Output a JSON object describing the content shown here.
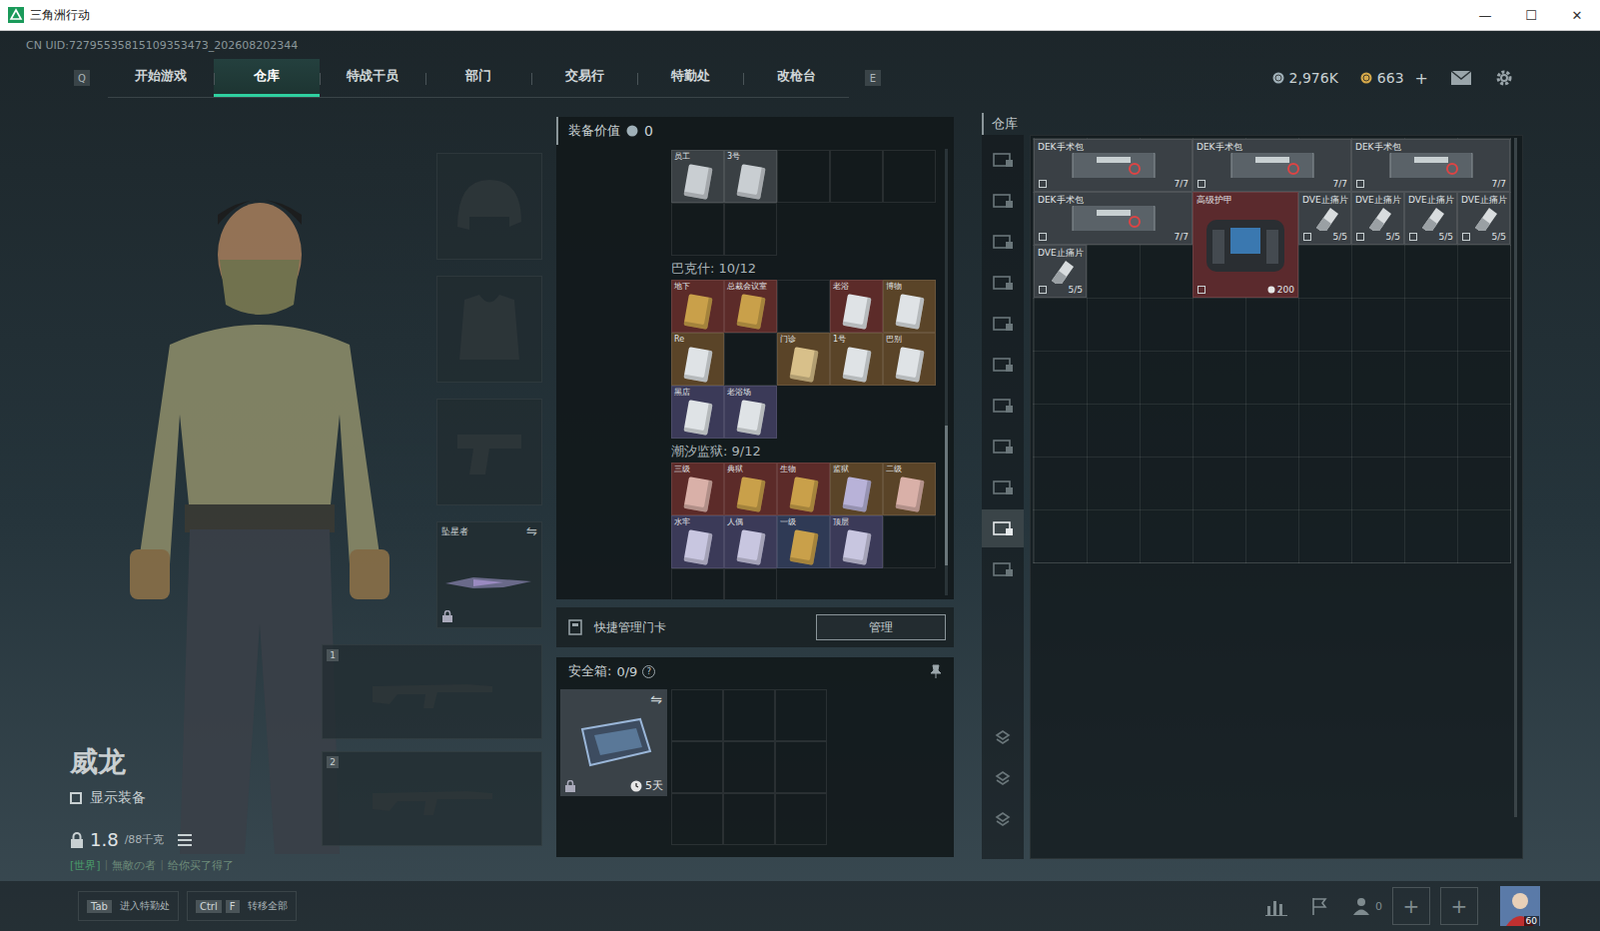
{
  "window": {
    "title": "三角洲行动",
    "controls": [
      "—",
      "☐",
      "✕"
    ]
  },
  "uid": "CN UID:72795535815109353473_202608202344",
  "nav": {
    "prev_key": "Q",
    "next_key": "E",
    "tabs": [
      {
        "label": "开始游戏",
        "selected": false
      },
      {
        "label": "仓库",
        "selected": true
      },
      {
        "label": "特战干员",
        "selected": false
      },
      {
        "label": "部门",
        "selected": false
      },
      {
        "label": "交易行",
        "selected": false
      },
      {
        "label": "特勤处",
        "selected": false
      },
      {
        "label": "改枪台",
        "selected": false
      }
    ]
  },
  "currency": [
    {
      "value": "2,976K",
      "color": "#9fb0b8",
      "add": ""
    },
    {
      "value": "663",
      "color": "#d4a84a",
      "add": "+"
    }
  ],
  "operator": {
    "name": "威龙",
    "show_gear": {
      "label": "显示装备",
      "checked": false
    },
    "weight": "1.8",
    "capacity": "/88千克"
  },
  "chat": {
    "channel": "[世界]",
    "sender": "無敵の者",
    "message": "给你买了得了"
  },
  "gear_slots": [
    {
      "kind": "helmet",
      "label": "",
      "swap": "",
      "locked": false
    },
    {
      "kind": "armor",
      "label": "",
      "swap": "",
      "locked": false
    },
    {
      "kind": "pistol",
      "label": "",
      "swap": "",
      "locked": false
    },
    {
      "kind": "melee",
      "label": "坠星者",
      "swap": "⇋",
      "locked": true
    }
  ],
  "weapon_slots": [
    "1",
    "2"
  ],
  "loadout": {
    "title": "装备价值",
    "value": "0"
  },
  "key_sections": [
    {
      "title": "",
      "slots": [
        {
          "label": "员工",
          "color": "#3a4044",
          "card": "#c9ced2",
          "empty": false
        },
        {
          "label": "3号",
          "color": "#3a4044",
          "card": "#c9ced2",
          "empty": false
        },
        {
          "empty": true
        },
        {
          "empty": true
        },
        {
          "empty": true
        },
        {
          "empty": true
        },
        {
          "empty": true
        }
      ]
    },
    {
      "title": "巴克什: 10/12",
      "slots": [
        {
          "label": "地下",
          "color": "#5c2b29",
          "card": "#c9a04a",
          "empty": false
        },
        {
          "label": "总裁会议室",
          "color": "#5c2b29",
          "card": "#c9a04a",
          "empty": false
        },
        {
          "empty": true
        },
        {
          "label": "老浴",
          "color": "#5c2b29",
          "card": "#dfe3e6",
          "empty": false
        },
        {
          "label": "博物",
          "color": "#5a4428",
          "card": "#dfe3e6",
          "empty": false
        },
        {
          "label": "Re",
          "color": "#5a4428",
          "card": "#dfe3e6",
          "empty": false
        },
        {
          "empty": true
        },
        {
          "label": "门诊",
          "color": "#5a4428",
          "card": "#d8c08a",
          "empty": false
        },
        {
          "label": "1号",
          "color": "#5a4428",
          "card": "#dfe3e6",
          "empty": false
        },
        {
          "label": "巴别",
          "color": "#5a4428",
          "card": "#dfe3e6",
          "empty": false
        },
        {
          "label": "黑店",
          "color": "#3b3a58",
          "card": "#dfe3e6",
          "empty": false
        },
        {
          "label": "老浴场",
          "color": "#3b3a58",
          "card": "#dfe3e6",
          "empty": false
        }
      ]
    },
    {
      "title": "潮汐监狱: 9/12",
      "slots": [
        {
          "label": "三级",
          "color": "#5c2b29",
          "card": "#d9b0a8",
          "empty": false
        },
        {
          "label": "典狱",
          "color": "#5c2b29",
          "card": "#c9a04a",
          "empty": false
        },
        {
          "label": "生物",
          "color": "#5c2b29",
          "card": "#c9a04a",
          "empty": false
        },
        {
          "label": "监狱",
          "color": "#5a4428",
          "card": "#b8b2d8",
          "empty": false
        },
        {
          "label": "二级",
          "color": "#5a4428",
          "card": "#d9b0a8",
          "empty": false
        },
        {
          "label": "水牢",
          "color": "#3b3a58",
          "card": "#c8c6e0",
          "empty": false
        },
        {
          "label": "人偶",
          "color": "#3b3a58",
          "card": "#c8c6e0",
          "empty": false
        },
        {
          "label": "一级",
          "color": "#2f3a55",
          "card": "#c9a04a",
          "empty": false
        },
        {
          "label": "顶层",
          "color": "#3b3a58",
          "card": "#c8c6e0",
          "empty": false
        },
        {
          "empty": true
        },
        {
          "empty": true
        },
        {
          "empty": true
        }
      ]
    }
  ],
  "quick_manage": {
    "label": "快捷管理门卡",
    "button": "管理"
  },
  "safe_box": {
    "title": "安全箱:",
    "count": "0/9",
    "help": "?",
    "timer": "5天",
    "swap": "⇋",
    "locked": true,
    "slots": 9
  },
  "warehouse": {
    "title": "仓库",
    "sidebar_top": [
      {
        "selected": false
      },
      {
        "selected": false
      },
      {
        "selected": false
      },
      {
        "selected": false
      },
      {
        "selected": false
      },
      {
        "selected": false
      },
      {
        "selected": false
      },
      {
        "selected": false
      },
      {
        "selected": false
      },
      {
        "selected": true
      },
      {
        "selected": false
      }
    ],
    "sidebar_bottom": [
      {
        "selected": false
      },
      {
        "selected": false
      },
      {
        "selected": false
      }
    ],
    "items": [
      {
        "name": "DEK手术包",
        "kind": "medkit",
        "count": "7/7",
        "color": "#3a4045"
      },
      {
        "name": "DEK手术包",
        "kind": "medkit",
        "count": "7/7",
        "color": "#3a4045"
      },
      {
        "name": "DEK手术包",
        "kind": "medkit",
        "count": "7/7",
        "color": "#3a4045"
      },
      {
        "name": "DEK手术包",
        "kind": "medkit",
        "count": "7/7",
        "color": "#3a4045"
      },
      {
        "name": "高级护甲",
        "kind": "armor",
        "count": "200",
        "color": "#5b2a2d"
      },
      {
        "name": "DVE止痛片",
        "kind": "pill",
        "count": "5/5",
        "color": "#3a4045"
      },
      {
        "name": "DVE止痛片",
        "kind": "pill",
        "count": "5/5",
        "color": "#3a4045"
      },
      {
        "name": "DVE止痛片",
        "kind": "pill",
        "count": "5/5",
        "color": "#3a4045"
      },
      {
        "name": "DVE止痛片",
        "kind": "pill",
        "count": "5/5",
        "color": "#3a4045"
      },
      {
        "name": "DVE止痛片",
        "kind": "pill",
        "count": "5/5",
        "color": "#3a4045"
      }
    ]
  },
  "bottom": {
    "hints": [
      {
        "keys": [
          "Tab"
        ],
        "label": "进入特勤处"
      },
      {
        "keys": [
          "Ctrl",
          "F"
        ],
        "label": "转移全部"
      }
    ],
    "friends": "0",
    "add_slots": [
      "+",
      "+"
    ],
    "level": "60"
  }
}
